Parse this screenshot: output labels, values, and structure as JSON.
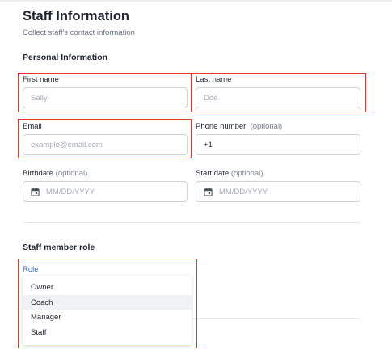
{
  "header": {
    "title": "Staff Information",
    "subtitle": "Collect staff's contact information"
  },
  "personal": {
    "heading": "Personal Information",
    "first_name": {
      "label": "First name",
      "placeholder": "Sally"
    },
    "last_name": {
      "label": "Last name",
      "placeholder": "Doe"
    },
    "email": {
      "label": "Email",
      "placeholder": "example@email.com"
    },
    "phone": {
      "label": "Phone number",
      "optional": "(optional)",
      "value": "+1"
    },
    "birthdate": {
      "label": "Birthdate",
      "optional": "(optional)",
      "placeholder": "MM/DD/YYYY"
    },
    "start_date": {
      "label": "Start date",
      "optional": "(optional)",
      "placeholder": "MM/DD/YYYY"
    }
  },
  "role_section": {
    "heading": "Staff member role",
    "role_label": "Role",
    "options": [
      "Owner",
      "Coach",
      "Manager",
      "Staff"
    ],
    "highlighted": "Coach"
  },
  "colors": {
    "annotation_red": "#e4372d",
    "accent_blue": "#2f6fd6",
    "border": "#cfd4db"
  },
  "icons": {
    "date": "calendar-icon"
  }
}
